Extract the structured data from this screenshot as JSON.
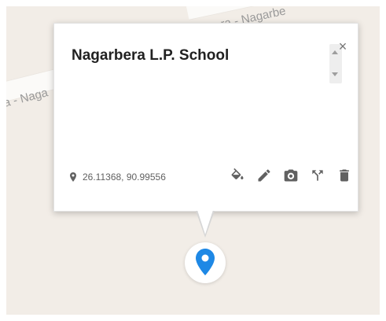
{
  "map": {
    "road_label_top": "ra - Nagarbe",
    "road_label_left": "a - Naga"
  },
  "popup": {
    "title": "Nagarbera L.P. School",
    "close_label": "×",
    "coordinates": "26.11368, 90.99556"
  },
  "toolbar": {
    "icons": [
      "paint-bucket-icon",
      "pencil-icon",
      "camera-icon",
      "route-fork-icon",
      "trash-icon"
    ]
  },
  "colors": {
    "marker": "#1e88e5",
    "icon": "#616161",
    "map_background": "#f2ede7"
  }
}
